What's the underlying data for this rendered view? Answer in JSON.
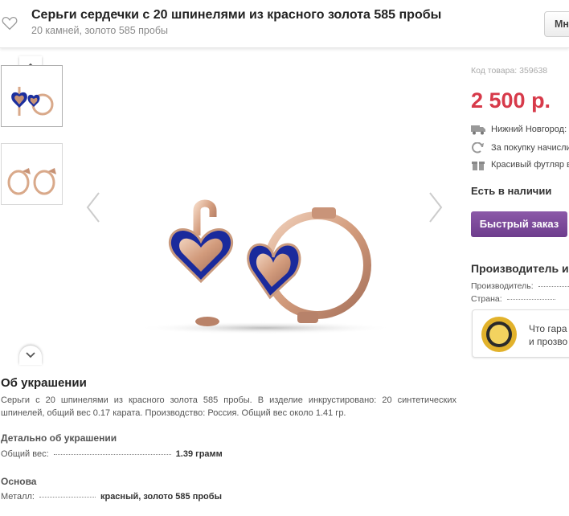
{
  "header": {
    "title": "Серьги сердечки с 20 шпинелями из красного золота 585 пробы",
    "subtitle": "20 камней, золото 585 пробы",
    "more_button": "Мно"
  },
  "about": {
    "title": "Об украшении",
    "text": "Серьги с 20 шпинелями из красного золота 585 пробы. В изделие инкрустировано: 20 синтетических шпинелей, общий вес 0.17 карата. Производство: Россия. Общий вес около 1.41 гр."
  },
  "details": {
    "title": "Детально об украшении",
    "rows": [
      {
        "label": "Общий вес:",
        "value": "1.39 грамм"
      }
    ]
  },
  "basis": {
    "title": "Основа",
    "rows": [
      {
        "label": "Металл:",
        "value": "красный, золото 585 пробы"
      }
    ]
  },
  "sidebar": {
    "sku": "Код товара: 359638",
    "price": "2 500 р.",
    "info": [
      {
        "icon": "truck-icon",
        "text": "Нижний Новгород:"
      },
      {
        "icon": "refresh-icon",
        "text": "За покупку начисли"
      },
      {
        "icon": "gift-icon",
        "text": "Красивый футляр в"
      }
    ],
    "stock": "Есть в наличии",
    "quick_order": "Быстрый заказ",
    "manufacturer": {
      "title": "Производитель и",
      "rows": [
        {
          "label": "Производитель:"
        },
        {
          "label": "Страна:"
        }
      ]
    },
    "guarantee": {
      "line1": "Что гара",
      "line2": "и прозво"
    }
  },
  "colors": {
    "price": "#d73a4a",
    "button": "#7a4899",
    "gold": "#d9a98a",
    "stone": "#1c2f9e"
  }
}
